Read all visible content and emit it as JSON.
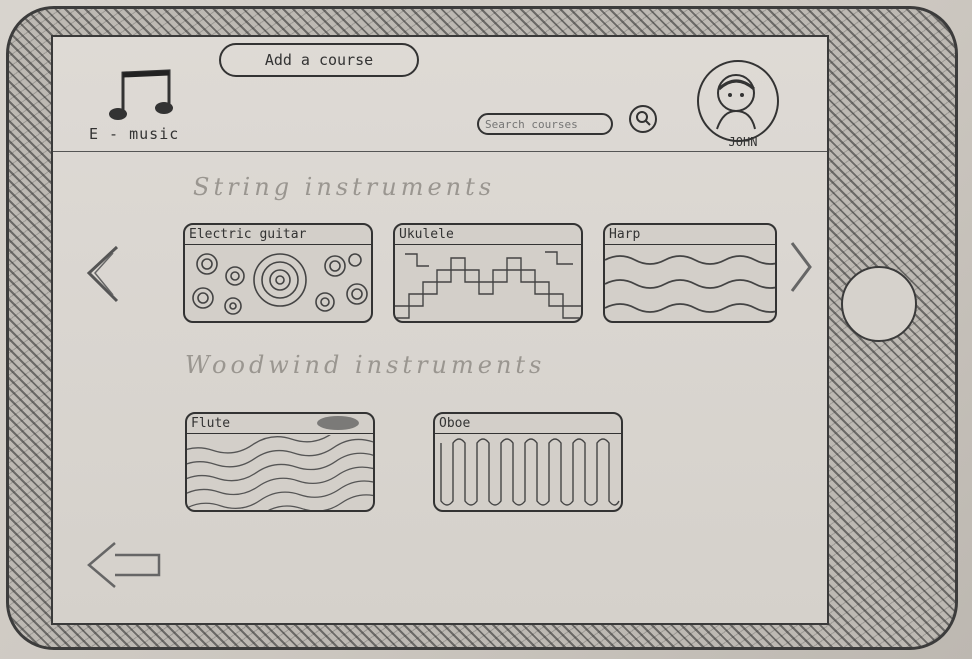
{
  "header": {
    "add_course_label": "Add a course",
    "logo_text": "E - music",
    "search_placeholder": "Search courses",
    "user_name": "JOHN"
  },
  "sections": [
    {
      "title": "String instruments",
      "courses": [
        {
          "label": "Electric guitar"
        },
        {
          "label": "Ukulele"
        },
        {
          "label": "Harp"
        }
      ]
    },
    {
      "title": "Woodwind instruments",
      "courses": [
        {
          "label": "Flute"
        },
        {
          "label": "Oboe"
        }
      ]
    }
  ],
  "icons": {
    "logo": "music-note-icon",
    "search": "search-icon",
    "avatar": "user-avatar-icon",
    "prev": "chevron-left-icon",
    "next": "chevron-right-icon",
    "back": "back-arrow-icon"
  }
}
